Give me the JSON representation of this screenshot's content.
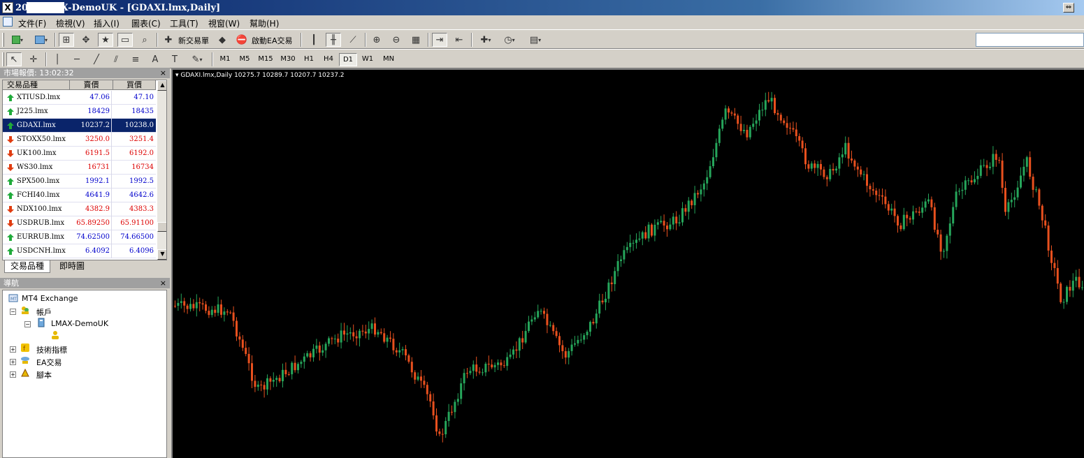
{
  "window": {
    "title": "20         : LMAX-DemoUK - [GDAXI.lmx,Daily]",
    "restore_glyph": "⇔"
  },
  "menu": [
    "文件(F)",
    "檢視(V)",
    "插入(I)",
    "圖表(C)",
    "工具(T)",
    "視窗(W)",
    "幫助(H)"
  ],
  "toolbar": {
    "new_order_label": "新交易單",
    "expert_advisors_label": "啟動EA交易"
  },
  "timeframes": [
    "M1",
    "M5",
    "M15",
    "M30",
    "H1",
    "H4",
    "D1",
    "W1",
    "MN"
  ],
  "active_timeframe": "D1",
  "market_watch": {
    "title": "市場報價: 13:02:32",
    "columns": [
      "交易品種",
      "賣價",
      "買價"
    ],
    "rows": [
      {
        "symbol": "XTIUSD.lmx",
        "bid": "47.06",
        "ask": "47.10",
        "dir": "up"
      },
      {
        "symbol": "J225.lmx",
        "bid": "18429",
        "ask": "18435",
        "dir": "up"
      },
      {
        "symbol": "GDAXI.lmx",
        "bid": "10237.2",
        "ask": "10238.0",
        "dir": "up",
        "selected": true
      },
      {
        "symbol": "STOXX50.lmx",
        "bid": "3250.0",
        "ask": "3251.4",
        "dir": "down"
      },
      {
        "symbol": "UK100.lmx",
        "bid": "6191.5",
        "ask": "6192.0",
        "dir": "down"
      },
      {
        "symbol": "WS30.lmx",
        "bid": "16731",
        "ask": "16734",
        "dir": "down"
      },
      {
        "symbol": "SPX500.lmx",
        "bid": "1992.1",
        "ask": "1992.5",
        "dir": "up"
      },
      {
        "symbol": "FCHI40.lmx",
        "bid": "4641.9",
        "ask": "4642.6",
        "dir": "up"
      },
      {
        "symbol": "NDX100.lmx",
        "bid": "4382.9",
        "ask": "4383.3",
        "dir": "down"
      },
      {
        "symbol": "USDRUB.lmx",
        "bid": "65.89250",
        "ask": "65.91100",
        "dir": "down"
      },
      {
        "symbol": "EURRUB.lmx",
        "bid": "74.62500",
        "ask": "74.66500",
        "dir": "up"
      },
      {
        "symbol": "USDCNH.lmx",
        "bid": "6.4092",
        "ask": "6.4096",
        "dir": "up"
      }
    ],
    "tabs": [
      "交易品種",
      "即時圖"
    ]
  },
  "navigator": {
    "title": "導航",
    "root": "MT4 Exchange",
    "accounts": "帳戶",
    "account_name": "LMAX-DemoUK",
    "indicators": "技術指標",
    "experts": "EA交易",
    "scripts": "腳本"
  },
  "chart": {
    "header": "GDAXI.lmx,Daily  10275.7 10289.7 10207.7 10237.2",
    "colors": {
      "bull": "#26a65b",
      "bear": "#e8501e",
      "background": "#000000"
    }
  }
}
